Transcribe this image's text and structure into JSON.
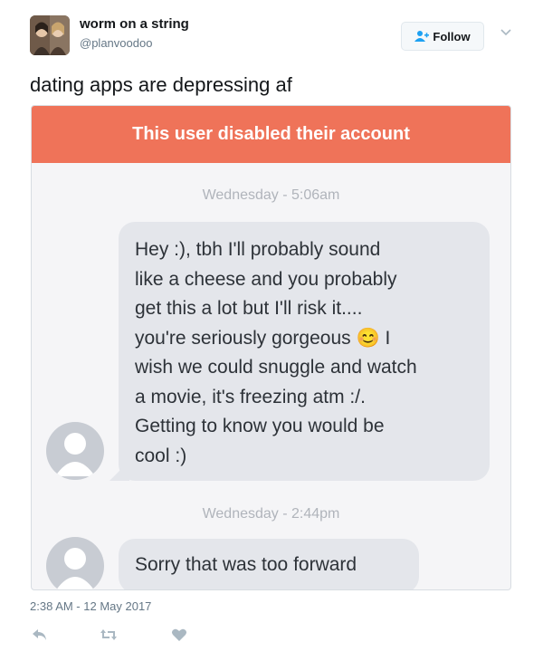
{
  "tweet": {
    "author_name": "worm on a string",
    "author_handle": "@planvoodoo",
    "follow_label": "Follow",
    "text": "dating apps are depressing af",
    "date": "2:38 AM - 12 May 2017"
  },
  "screenshot": {
    "banner": "This user disabled their account",
    "messages": [
      {
        "timestamp": "Wednesday - 5:06am",
        "lines": [
          "Hey :), tbh I'll probably sound",
          "like a cheese and you probably",
          "get this a lot but I'll risk it....",
          "you're seriously gorgeous 😊 I",
          "wish we could snuggle and watch",
          "a movie, it's freezing atm :/.",
          "Getting to know you would be",
          "cool :)"
        ]
      },
      {
        "timestamp": "Wednesday - 2:44pm",
        "lines": [
          "Sorry that was too forward"
        ]
      }
    ]
  },
  "colors": {
    "banner": "#ef7359",
    "bubble": "#e4e6eb",
    "accent": "#1da1f2"
  },
  "icons": [
    "add-user-icon",
    "chevron-down-icon",
    "reply-icon",
    "retweet-icon",
    "like-icon",
    "person-placeholder-icon"
  ]
}
